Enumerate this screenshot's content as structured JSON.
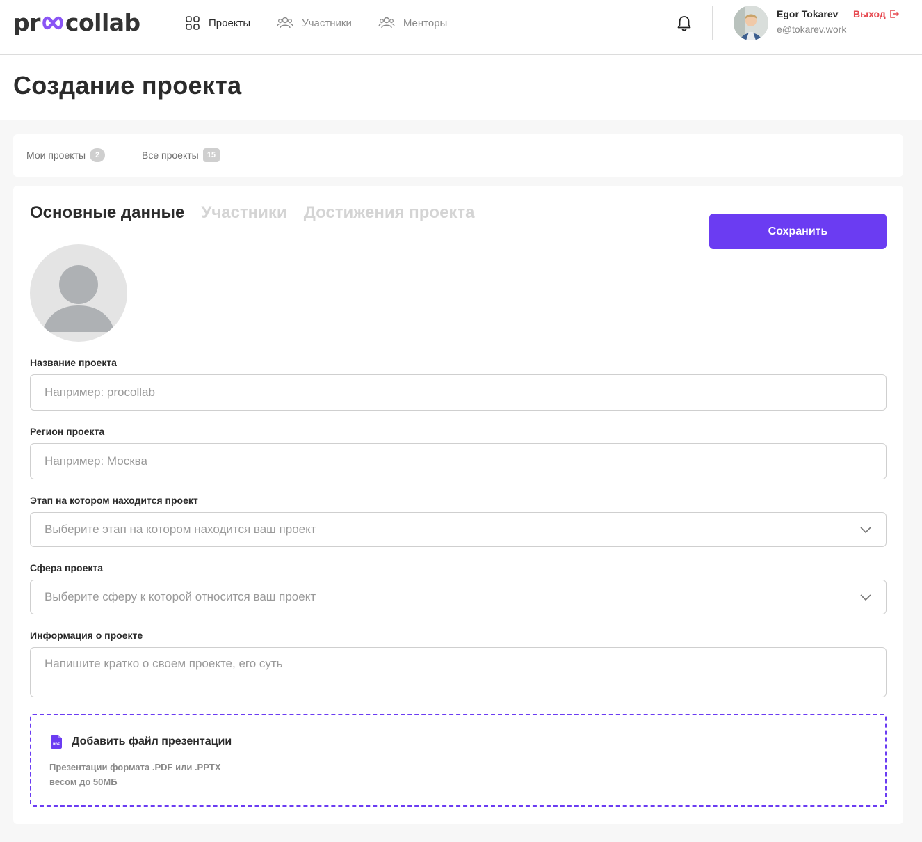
{
  "brand": {
    "logo_left": "pr",
    "logo_right": "collab",
    "accent_color": "#6b3cf2"
  },
  "nav": {
    "items": [
      {
        "label": "Проекты",
        "icon": "grid-icon",
        "active": true
      },
      {
        "label": "Участники",
        "icon": "users-icon",
        "active": false
      },
      {
        "label": "Менторы",
        "icon": "users-icon",
        "active": false
      }
    ]
  },
  "user": {
    "name": "Egor Tokarev",
    "email": "e@tokarev.work",
    "logout_label": "Выход"
  },
  "page": {
    "title": "Создание проекта"
  },
  "project_tabs": [
    {
      "label": "Мои проекты",
      "count": "2"
    },
    {
      "label": "Все проекты",
      "count": "15"
    }
  ],
  "section_tabs": [
    {
      "label": "Основные данные",
      "active": true
    },
    {
      "label": "Участники",
      "active": false
    },
    {
      "label": "Достижения проекта",
      "active": false
    }
  ],
  "save_label": "Сохранить",
  "form": {
    "name": {
      "label": "Название проекта",
      "placeholder": "Например: procollab",
      "value": ""
    },
    "region": {
      "label": "Регион проекта",
      "placeholder": "Например: Москва",
      "value": ""
    },
    "stage": {
      "label": "Этап на котором находится проект",
      "placeholder": "Выберите этап на котором находится ваш проект"
    },
    "industry": {
      "label": "Сфера проекта",
      "placeholder": "Выберите сферу к которой относится ваш проект"
    },
    "description": {
      "label": "Информация о проекте",
      "placeholder": "Напишите кратко о своем проекте, его суть",
      "value": ""
    }
  },
  "upload": {
    "title": "Добавить файл презентации",
    "hint_line1": "Презентации формата .PDF или .PPTX",
    "hint_line2": "весом до 50МБ",
    "icon": "pdf-file-icon",
    "icon_label": "PDF"
  }
}
